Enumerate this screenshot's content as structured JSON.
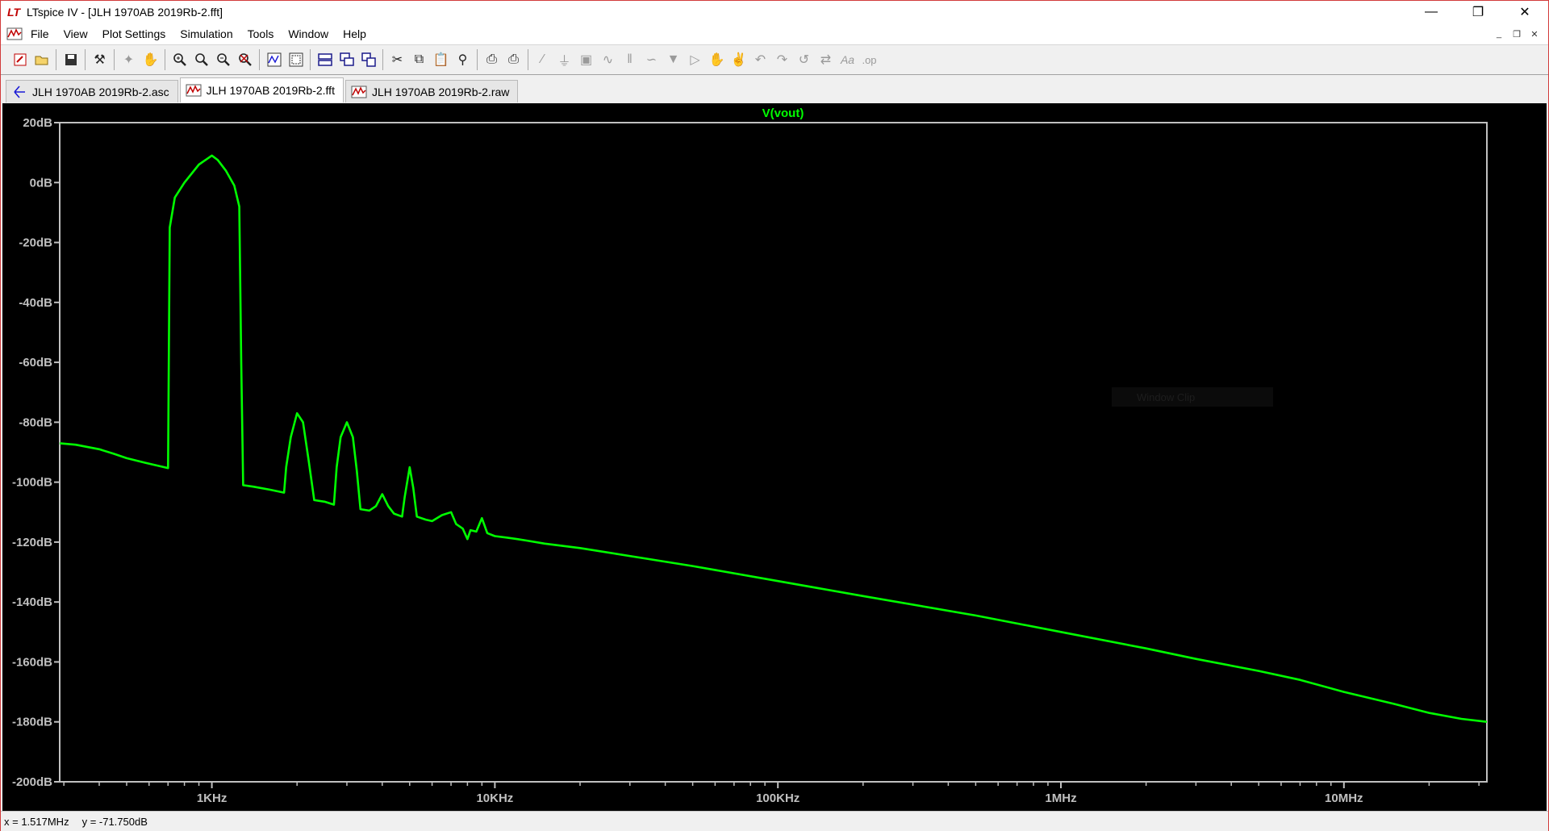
{
  "window": {
    "title": "LTspice IV - [JLH 1970AB 2019Rb-2.fft]",
    "controls": {
      "minimize": "—",
      "restore": "❐",
      "close": "✕"
    }
  },
  "menu": {
    "items": [
      "File",
      "View",
      "Plot Settings",
      "Simulation",
      "Tools",
      "Window",
      "Help"
    ],
    "mdi": {
      "minimize": "_",
      "restore": "❐",
      "close": "✕"
    }
  },
  "toolbar": {
    "icons": [
      "new-schematic-icon",
      "open-icon",
      "save-icon",
      "control-panel-icon",
      "run-icon",
      "halt-icon",
      "zoom-in-icon",
      "zoom-area-icon",
      "zoom-out-icon",
      "zoom-cancel-icon",
      "autorange-icon",
      "zoom-fit-icon",
      "tile-horizontal-icon",
      "cascade-icon",
      "tile-vertical-icon",
      "cut-icon",
      "copy-icon",
      "paste-icon",
      "find-icon",
      "print-preview-icon",
      "print-icon",
      "wire-icon",
      "ground-icon",
      "label-icon",
      "resistor-icon",
      "capacitor-icon",
      "inductor-icon",
      "diode-icon",
      "component-icon",
      "move-icon",
      "drag-icon",
      "undo-icon",
      "redo-icon",
      "rotate-icon",
      "mirror-icon",
      "text-icon",
      "spice-directive-icon"
    ]
  },
  "tabs": [
    {
      "label": "JLH 1970AB 2019Rb-2.asc",
      "icon": "schematic-icon",
      "active": false
    },
    {
      "label": "JLH 1970AB 2019Rb-2.fft",
      "icon": "waveform-icon",
      "active": true
    },
    {
      "label": "JLH 1970AB 2019Rb-2.raw",
      "icon": "waveform-icon",
      "active": false
    }
  ],
  "chart_data": {
    "type": "line",
    "title": "V(vout)",
    "xlabel": "",
    "ylabel": "",
    "x_scale": "log",
    "xlim_hz": [
      290,
      32000000
    ],
    "ylim": [
      -200,
      20
    ],
    "x_ticks": [
      {
        "value": 1000,
        "label": "1KHz"
      },
      {
        "value": 10000,
        "label": "10KHz"
      },
      {
        "value": 100000,
        "label": "100KHz"
      },
      {
        "value": 1000000,
        "label": "1MHz"
      },
      {
        "value": 10000000,
        "label": "10MHz"
      }
    ],
    "y_ticks": [
      {
        "value": 20,
        "label": "20dB"
      },
      {
        "value": 0,
        "label": "0dB"
      },
      {
        "value": -20,
        "label": "-20dB"
      },
      {
        "value": -40,
        "label": "-40dB"
      },
      {
        "value": -60,
        "label": "-60dB"
      },
      {
        "value": -80,
        "label": "-80dB"
      },
      {
        "value": -100,
        "label": "-100dB"
      },
      {
        "value": -120,
        "label": "-120dB"
      },
      {
        "value": -140,
        "label": "-140dB"
      },
      {
        "value": -160,
        "label": "-160dB"
      },
      {
        "value": -180,
        "label": "-180dB"
      },
      {
        "value": -200,
        "label": "-200dB"
      }
    ],
    "grid": false,
    "colors": {
      "background": "#000000",
      "trace": "#00ff00",
      "axis": "#c0c0c0",
      "labels": "#c0c0c0"
    },
    "series": [
      {
        "name": "V(vout)",
        "points": [
          [
            290,
            -87
          ],
          [
            330,
            -87.5
          ],
          [
            400,
            -89
          ],
          [
            450,
            -90.5
          ],
          [
            500,
            -92
          ],
          [
            580,
            -93.5
          ],
          [
            680,
            -95
          ],
          [
            700,
            -95.3
          ],
          [
            710,
            -15
          ],
          [
            740,
            -5
          ],
          [
            800,
            0
          ],
          [
            900,
            6
          ],
          [
            1000,
            9
          ],
          [
            1050,
            7.5
          ],
          [
            1120,
            4
          ],
          [
            1200,
            -1
          ],
          [
            1250,
            -8
          ],
          [
            1270,
            -60
          ],
          [
            1290,
            -101
          ],
          [
            1400,
            -101.5
          ],
          [
            1600,
            -102.5
          ],
          [
            1800,
            -103.5
          ],
          [
            1830,
            -95
          ],
          [
            1900,
            -85
          ],
          [
            2000,
            -77
          ],
          [
            2100,
            -80
          ],
          [
            2200,
            -93
          ],
          [
            2300,
            -106
          ],
          [
            2500,
            -106.5
          ],
          [
            2700,
            -107.5
          ],
          [
            2760,
            -95
          ],
          [
            2850,
            -85
          ],
          [
            3000,
            -80
          ],
          [
            3150,
            -85
          ],
          [
            3250,
            -96
          ],
          [
            3350,
            -109
          ],
          [
            3600,
            -109.5
          ],
          [
            3800,
            -108
          ],
          [
            4000,
            -104
          ],
          [
            4200,
            -108
          ],
          [
            4400,
            -110.5
          ],
          [
            4700,
            -111.5
          ],
          [
            4800,
            -105
          ],
          [
            5000,
            -95
          ],
          [
            5150,
            -102
          ],
          [
            5300,
            -111.5
          ],
          [
            5700,
            -112.5
          ],
          [
            6000,
            -113
          ],
          [
            6500,
            -111
          ],
          [
            7000,
            -110
          ],
          [
            7300,
            -114
          ],
          [
            7700,
            -115.5
          ],
          [
            8000,
            -119
          ],
          [
            8200,
            -116
          ],
          [
            8600,
            -116.5
          ],
          [
            9000,
            -112
          ],
          [
            9400,
            -117
          ],
          [
            10000,
            -118
          ],
          [
            11000,
            -118.5
          ],
          [
            12000,
            -119
          ],
          [
            13000,
            -119.5
          ],
          [
            15000,
            -120.5
          ],
          [
            20000,
            -122
          ],
          [
            50000,
            -128
          ],
          [
            100000,
            -133
          ],
          [
            200000,
            -138
          ],
          [
            500000,
            -144.5
          ],
          [
            1000000,
            -150
          ],
          [
            2000000,
            -155.5
          ],
          [
            3000000,
            -159
          ],
          [
            5000000,
            -163
          ],
          [
            7000000,
            -166
          ],
          [
            10000000,
            -170
          ],
          [
            15000000,
            -174
          ],
          [
            20000000,
            -177
          ],
          [
            26000000,
            -179
          ],
          [
            32000000,
            -180
          ]
        ]
      }
    ]
  },
  "plot_overlay": {
    "watermark": "Window Clip"
  },
  "status": {
    "x": "x = 1.517MHz",
    "y": "y = -71.750dB"
  }
}
